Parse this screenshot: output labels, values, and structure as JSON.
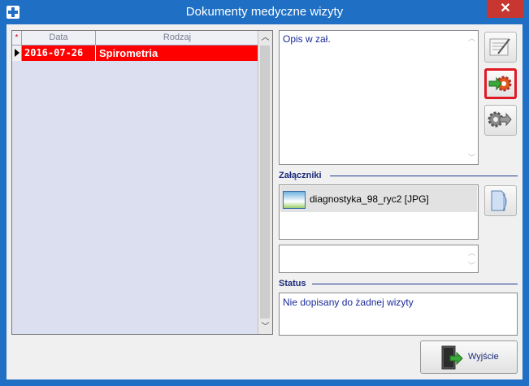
{
  "window": {
    "title": "Dokumenty medyczne wizyty",
    "close_glyph": "✕"
  },
  "grid": {
    "headers": {
      "marker": "*",
      "date": "Data",
      "type": "Rodzaj"
    },
    "rows": [
      {
        "date": "2016-07-26",
        "type": "Spirometria",
        "selected": true
      }
    ],
    "scroll_up": "︿",
    "scroll_down": "﹀"
  },
  "description": {
    "text": "Opis w zał."
  },
  "attachments": {
    "label": "Załączniki",
    "items": [
      {
        "name": "diagnostyka_98_ryc2 [JPG]",
        "icon": "image-thumbnail-icon"
      }
    ]
  },
  "status": {
    "label": "Status",
    "text": "Nie dopisany do żadnej wizyty"
  },
  "buttons": {
    "edit": {
      "icon": "document-edit-icon"
    },
    "add_to_visit": {
      "icon": "arrow-into-gear-icon",
      "highlight": "#e01a24"
    },
    "remove_from_visit": {
      "icon": "gear-arrow-out-icon"
    },
    "open_attachment": {
      "icon": "folder-icon"
    },
    "exit": {
      "label": "Wyjście",
      "icon": "exit-door-icon"
    }
  },
  "colors": {
    "title_bar": "#1f6fc4",
    "selected_row": "#ff0000",
    "close": "#c7372f"
  }
}
